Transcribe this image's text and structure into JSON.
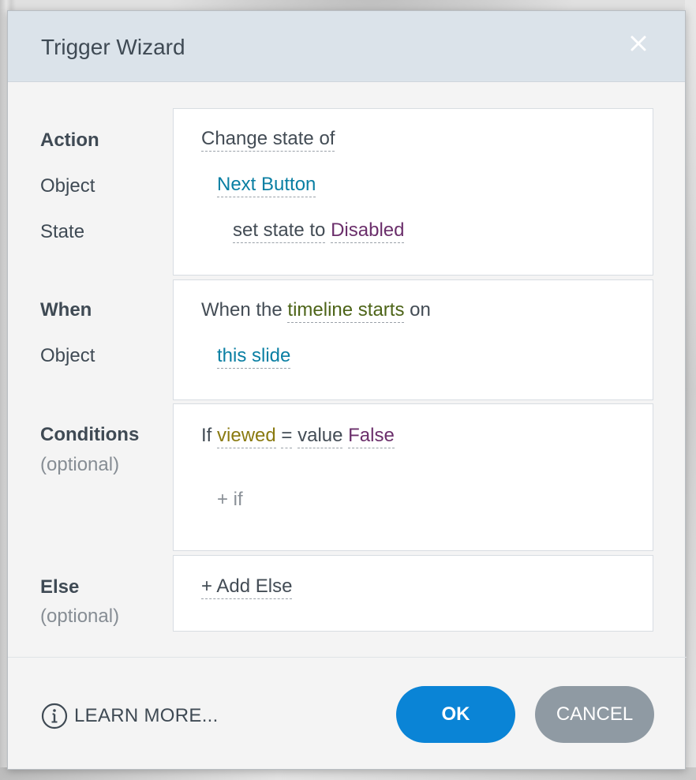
{
  "dialog": {
    "title": "Trigger Wizard",
    "close_icon": "close-icon"
  },
  "action_section": {
    "labels": [
      "Action",
      "Object",
      "State"
    ],
    "action_text": "Change state of",
    "object_value": "Next Button",
    "state_prefix": "set state to",
    "state_value": "Disabled"
  },
  "when_section": {
    "labels": [
      "When",
      "Object"
    ],
    "prefix": "When the",
    "event_value": "timeline starts",
    "suffix": "on",
    "object_value": "this slide"
  },
  "conditions_section": {
    "label": "Conditions",
    "optional": "(optional)",
    "if_word": "If",
    "variable": "viewed",
    "operator": "=",
    "value_type": "value",
    "value": "False",
    "add_condition": "+ if"
  },
  "else_section": {
    "label": "Else",
    "optional": "(optional)",
    "add_else": "+ Add Else"
  },
  "footer": {
    "learn_more": "LEARN MORE...",
    "info_icon": "info-icon",
    "ok_label": "OK",
    "cancel_label": "CANCEL"
  },
  "colors": {
    "title_bar": "#dbe3ea",
    "ok_button": "#0a84d6",
    "cancel_button": "#8f9aa3",
    "object_link": "#0a7fa3",
    "state_value": "#6b2f6b",
    "event_value": "#4d6418",
    "variable": "#8a7a10"
  }
}
